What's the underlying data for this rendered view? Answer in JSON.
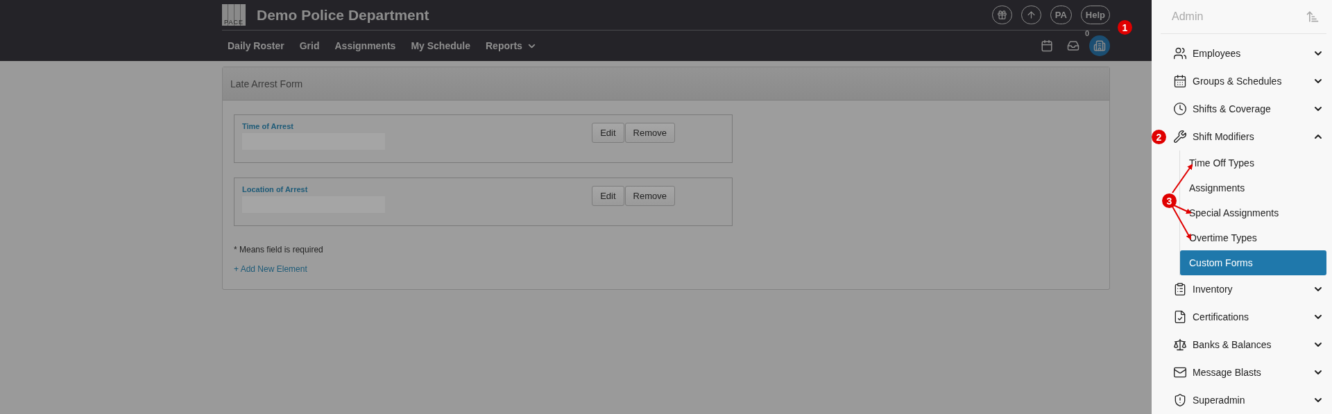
{
  "header": {
    "logo": "PACE",
    "title": "Demo Police Department",
    "actions": [
      {
        "kind": "gift"
      },
      {
        "kind": "upload"
      },
      {
        "kind": "text",
        "label": "PA"
      },
      {
        "kind": "text",
        "label": "Help"
      }
    ],
    "nav": [
      {
        "label": "Daily Roster",
        "has_menu": false
      },
      {
        "label": "Grid",
        "has_menu": false
      },
      {
        "label": "Assignments",
        "has_menu": false
      },
      {
        "label": "My Schedule",
        "has_menu": false
      },
      {
        "label": "Reports",
        "has_menu": true
      }
    ],
    "tools": [
      {
        "kind": "calendar"
      },
      {
        "kind": "inbox",
        "count": "0"
      },
      {
        "kind": "building",
        "selected": true
      }
    ]
  },
  "form": {
    "title": "Late Arrest Form",
    "elements": [
      {
        "label": "Time of Arrest",
        "buttons": [
          "Edit",
          "Remove"
        ]
      },
      {
        "label": "Location of Arrest",
        "buttons": [
          "Edit",
          "Remove"
        ]
      }
    ],
    "note": "* Means field is required",
    "add_link": "+ Add New Element"
  },
  "sidebar": {
    "title": "Admin",
    "items": [
      {
        "label": "Employees",
        "expanded": false
      },
      {
        "label": "Groups & Schedules",
        "expanded": false
      },
      {
        "label": "Shifts & Coverage",
        "expanded": false
      },
      {
        "label": "Shift Modifiers",
        "expanded": true,
        "children": [
          {
            "label": "Time Off Types",
            "selected": false
          },
          {
            "label": "Assignments",
            "selected": false
          },
          {
            "label": "Special Assignments",
            "selected": false
          },
          {
            "label": "Overtime Types",
            "selected": false
          },
          {
            "label": "Custom Forms",
            "selected": true
          }
        ]
      },
      {
        "label": "Inventory",
        "expanded": false
      },
      {
        "label": "Certifications",
        "expanded": false
      },
      {
        "label": "Banks & Balances",
        "expanded": false
      },
      {
        "label": "Message Blasts",
        "expanded": false
      },
      {
        "label": "Superadmin",
        "expanded": false
      }
    ]
  },
  "callouts": [
    {
      "label": "1"
    },
    {
      "label": "2"
    },
    {
      "label": "3"
    }
  ]
}
